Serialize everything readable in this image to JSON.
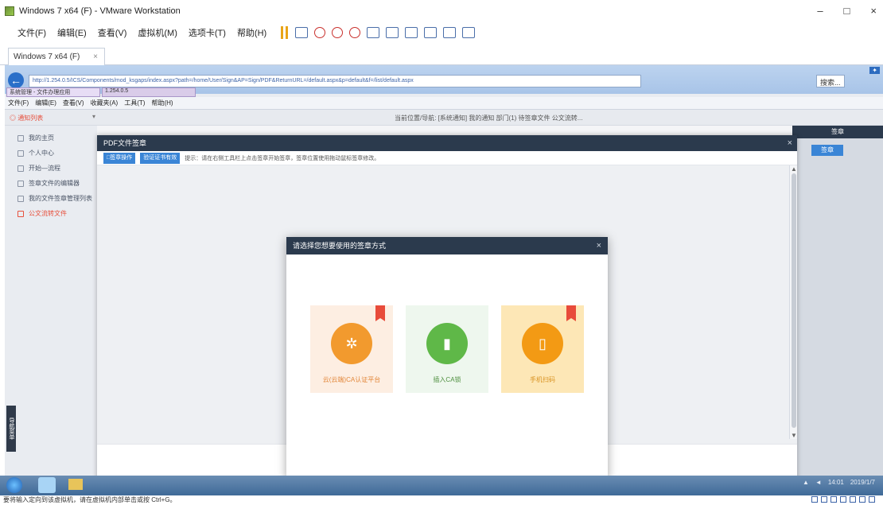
{
  "vmware": {
    "title": "Windows 7 x64 (F) - VMware Workstation",
    "menu": [
      "文件(F)",
      "编辑(E)",
      "查看(V)",
      "虚拟机(M)",
      "选项卡(T)",
      "帮助(H)"
    ],
    "tab_label": "Windows 7 x64 (F)",
    "status_text": "要将输入定向到该虚拟机，请在虚拟机内部单击或按 Ctrl+G。"
  },
  "browser": {
    "address": "http://1.254.0.5/ICS/Components/mod_ksgaps/index.aspx?path=/home/User/Sign&AP=Sign/PDF&ReturnURL=/default.aspx&p=default&f=/list/default.aspx",
    "tab1": "系统管理 - 文件办理应用",
    "tab2": "1.254.0.5",
    "menu": [
      "文件(F)",
      "编辑(E)",
      "查看(V)",
      "收藏夹(A)",
      "工具(T)",
      "帮助(H)"
    ],
    "search_placeholder": "搜索..."
  },
  "app": {
    "nav_title": "◎ 通知列表",
    "nav_notice": "当前位置/导航: [系统通知] 我的通知 部门(1) 待签章文件 公文流转...",
    "sidebar": [
      {
        "label": "我的主页",
        "active": false
      },
      {
        "label": "个人中心",
        "active": false
      },
      {
        "label": "开始—流程",
        "active": false
      },
      {
        "label": "签章文件的编辑器",
        "active": false
      },
      {
        "label": "我的文件签章管理列表",
        "active": false
      },
      {
        "label": "公文流转文件",
        "active": true
      }
    ],
    "side_vertical_tab": "导航菜单",
    "right_header": "签章",
    "right_button": "签章"
  },
  "pdf_dialog": {
    "title": "PDF文件签章",
    "btn_sign": "□签章操作",
    "btn_verify": "验证证书有效",
    "tip": "提示：请在右侧工具栏上点击签章开始签章，签章位置使用拖动鼠标签章修改。"
  },
  "sign_modal": {
    "title": "请选择您想要使用的签章方式",
    "options": [
      {
        "label": "云(云端)CA认证平台",
        "icon": "cloud-ca-icon",
        "flag": true
      },
      {
        "label": "插入CA锁",
        "icon": "usb-key-icon",
        "flag": false
      },
      {
        "label": "手机扫码",
        "icon": "mobile-phone-icon",
        "flag": true
      }
    ]
  },
  "taskbar": {
    "time": "14:01",
    "date": "2019/1/7"
  }
}
